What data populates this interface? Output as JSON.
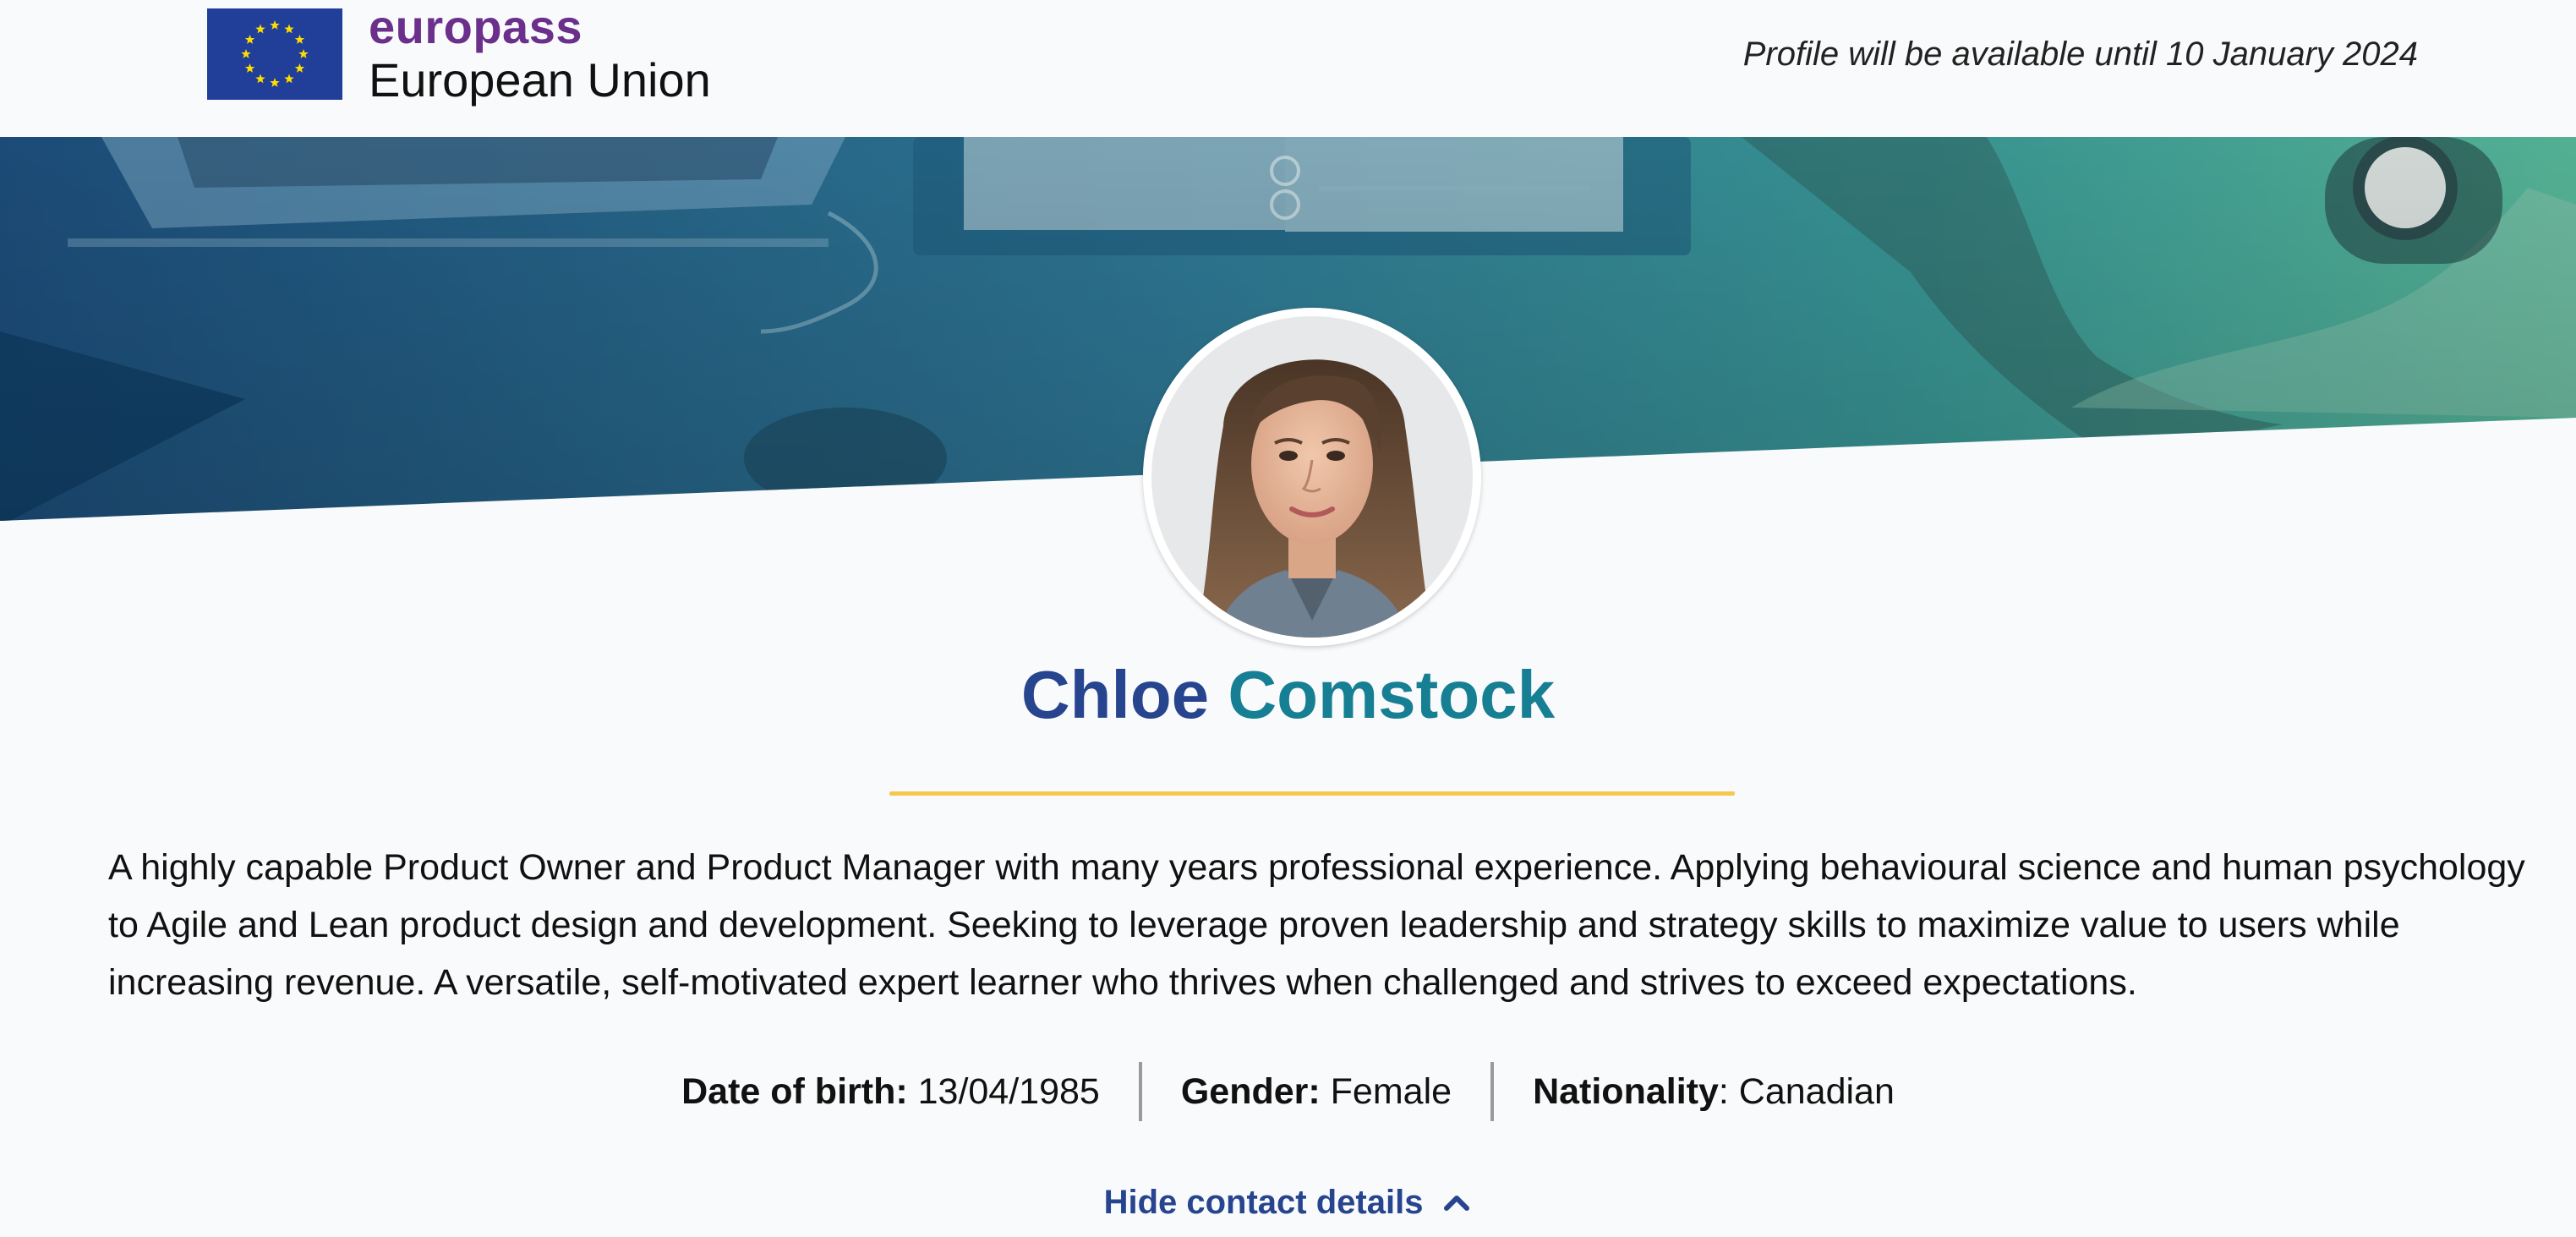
{
  "header": {
    "brand_name": "europass",
    "brand_sub": "European Union",
    "availability": "Profile will be available until 10 January 2024"
  },
  "profile": {
    "first_name": "Chloe",
    "last_name": "Comstock",
    "summary": "A highly capable Product Owner and Product Manager with many years professional experience. Applying behavioural science and human psychology to Agile and Lean product design and development. Seeking to leverage proven leadership and strategy skills to maximize value to users while increasing revenue. A versatile, self-motivated expert learner who thrives when challenged and strives to exceed expectations.",
    "details": [
      {
        "label": "Date of birth:",
        "value": " 13/04/1985"
      },
      {
        "label": "Gender:",
        "value": " Female"
      },
      {
        "label": "Nationality",
        "value": ": Canadian"
      }
    ]
  },
  "contact_toggle": {
    "label": "Hide contact details",
    "icon": "chevron-up-icon"
  },
  "colors": {
    "brand_purple": "#6b2f8c",
    "name_blue": "#27448f",
    "name_teal": "#167f93",
    "divider_yellow": "#f6c851",
    "flag_blue": "#213f99",
    "flag_star": "#ffdd00"
  }
}
